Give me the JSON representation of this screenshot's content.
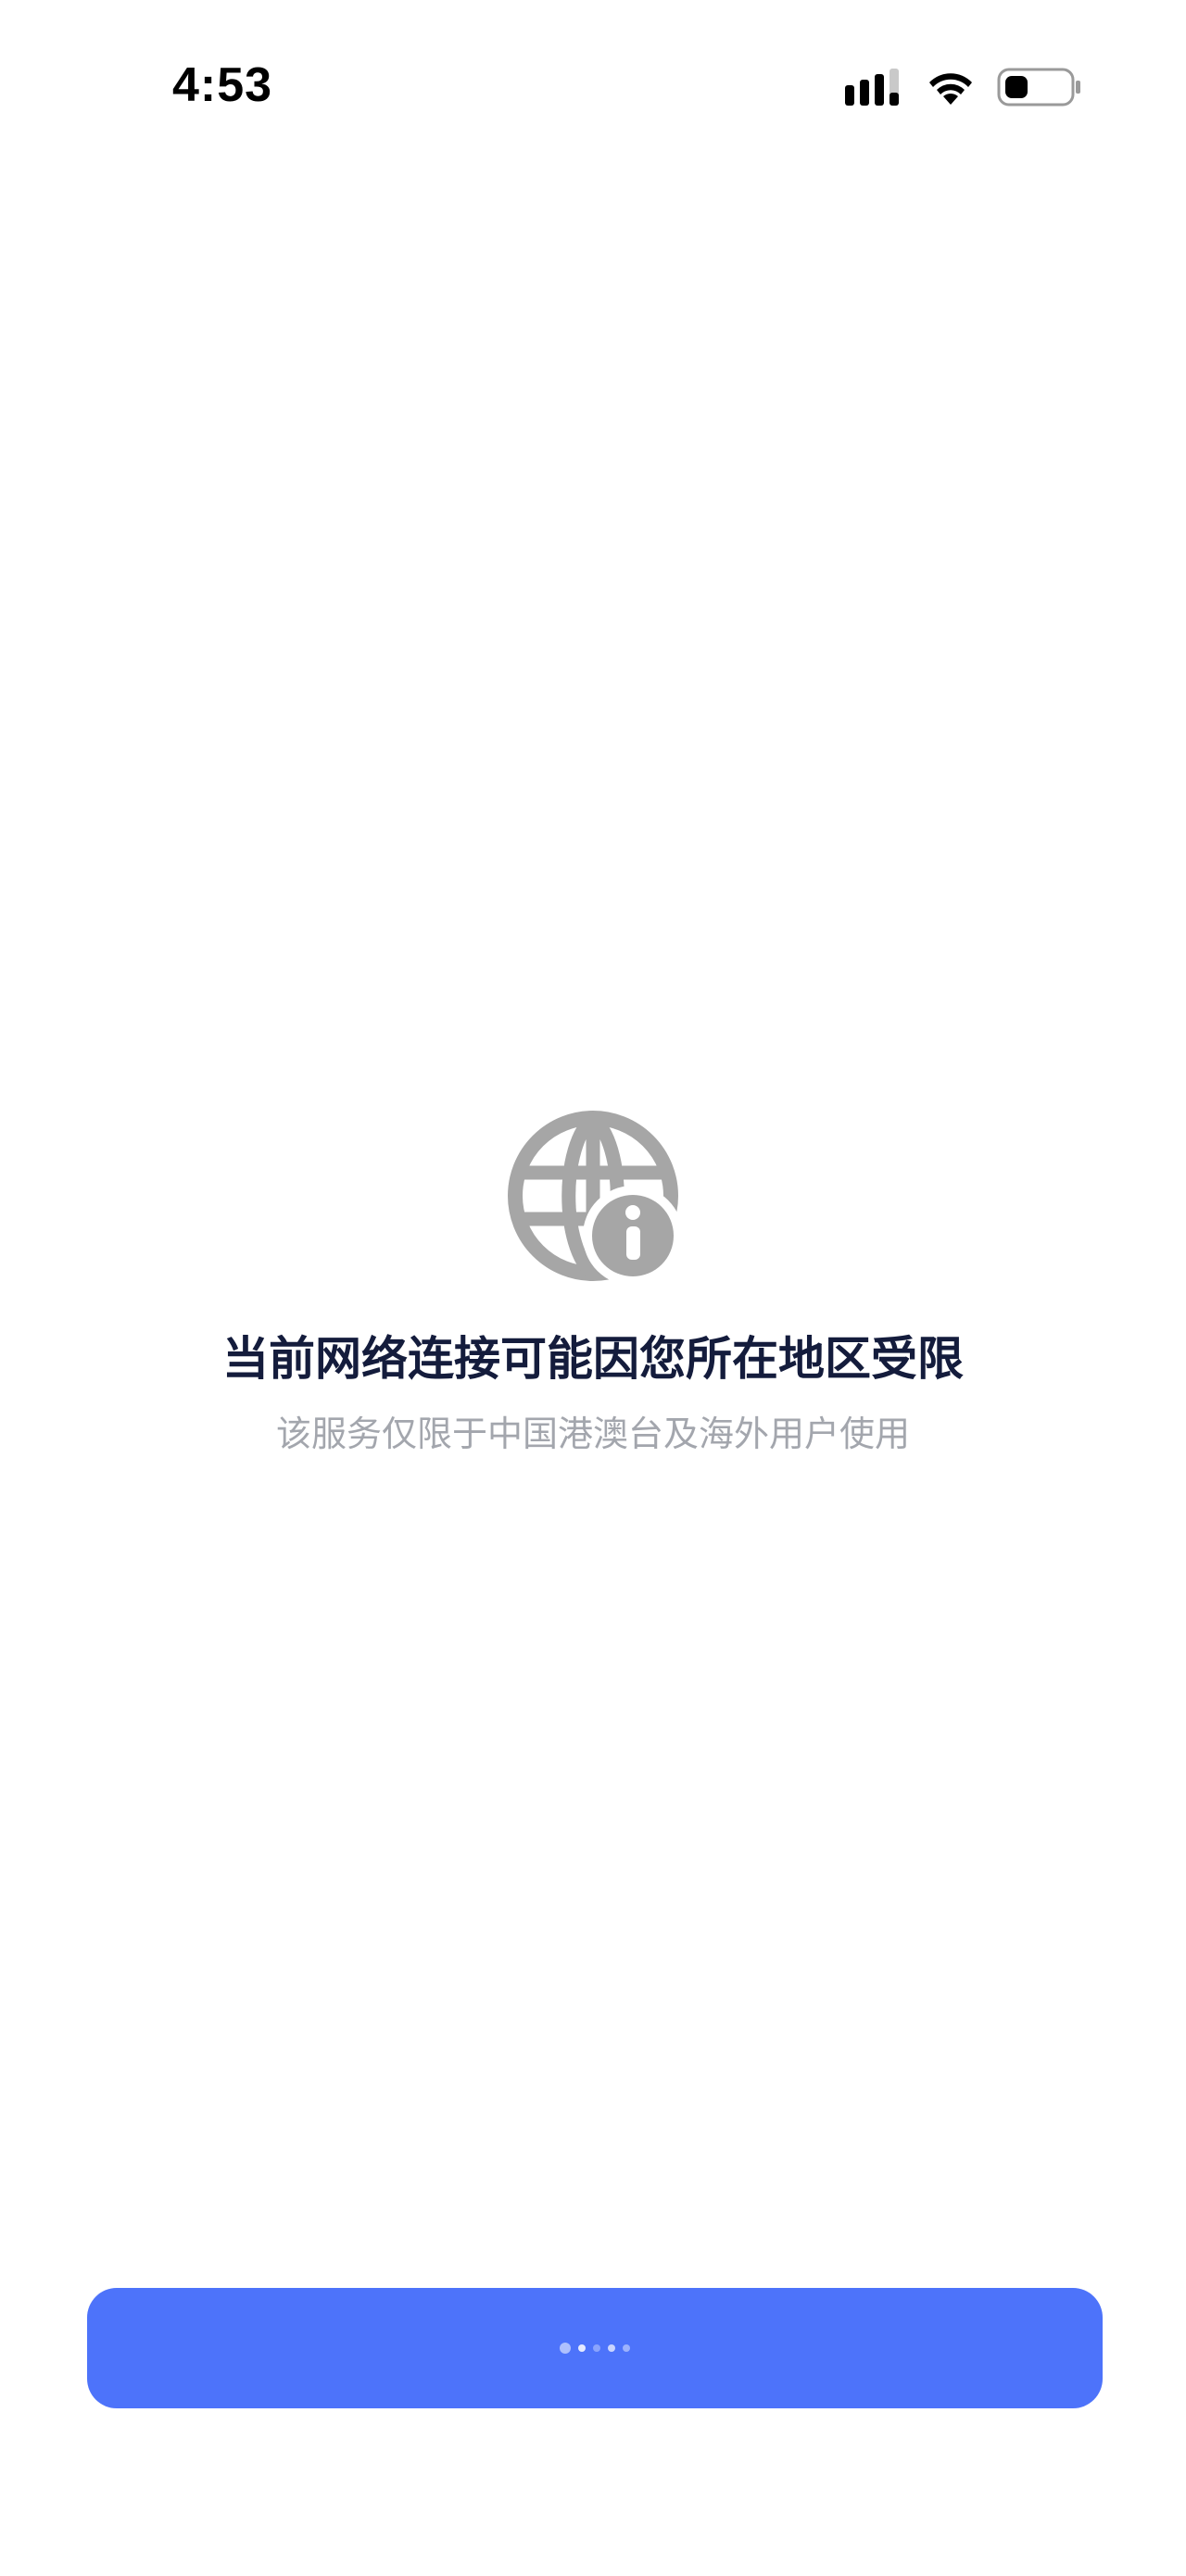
{
  "status_bar": {
    "time": "4:53",
    "icons": [
      "cellular-signal-icon",
      "wifi-icon",
      "battery-icon"
    ]
  },
  "main": {
    "icon": "globe-info-icon",
    "title": "当前网络连接可能因您所在地区受限",
    "subtitle": "该服务仅限于中国港澳台及海外用户使用"
  },
  "footer": {
    "button_icon": "loading-spinner-icon"
  },
  "colors": {
    "background": "#ffffff",
    "title": "#141c3c",
    "subtitle": "#a3a6ad",
    "icon": "#a6a6a6",
    "button": "#4d73fa"
  }
}
